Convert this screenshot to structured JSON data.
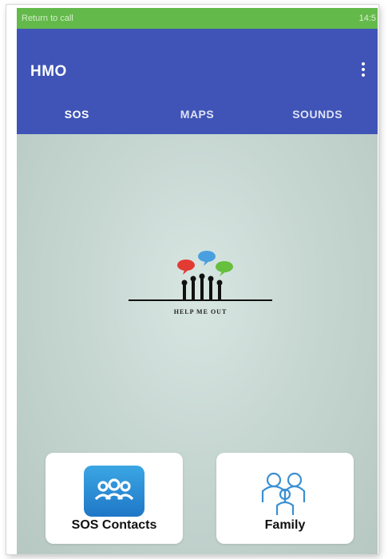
{
  "status_bar": {
    "left_text": "Return to call",
    "right_text": "14:5"
  },
  "app_bar": {
    "title": "HMO",
    "more_icon": "more-vert-icon"
  },
  "tabs": [
    {
      "label": "SOS",
      "active": true
    },
    {
      "label": "MAPS",
      "active": false
    },
    {
      "label": "SOUNDS",
      "active": false
    }
  ],
  "logo": {
    "caption": "HELP ME OUT"
  },
  "cards": [
    {
      "label": "SOS Contacts",
      "icon": "contacts-icon"
    },
    {
      "label": "Family",
      "icon": "family-icon"
    }
  ],
  "colors": {
    "status_bar": "#63b94a",
    "app_bar": "#3f54b6",
    "tab_indicator": "#e1626f",
    "background": "#c6d6d1",
    "contacts_icon": "#2a8ed6",
    "family_icon": "#3b8fd1"
  }
}
